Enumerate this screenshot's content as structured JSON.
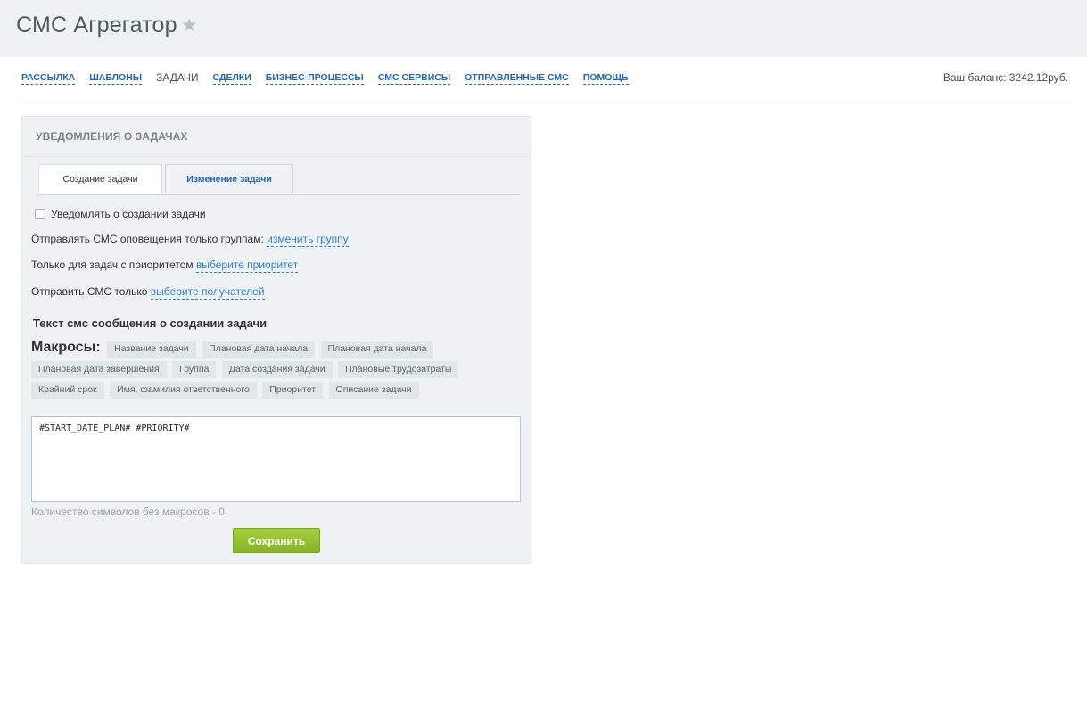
{
  "header": {
    "title": "СМС Агрегатор",
    "star": "★"
  },
  "nav": {
    "items": [
      "РАССЫЛКА",
      "ШАБЛОНЫ",
      "ЗАДАЧИ",
      "СДЕЛКИ",
      "БИЗНЕС-ПРОЦЕССЫ",
      "СМС СЕРВИСЫ",
      "ОТПРАВЛЕННЫЕ СМС",
      "ПОМОЩЬ"
    ],
    "active": "ЗАДАЧИ",
    "balance_label": "Ваш баланс: 3242.12руб."
  },
  "panel": {
    "title": "УВЕДОМЛЕНИЯ О ЗАДАЧАХ",
    "tabs": [
      {
        "label": "Создание задачи"
      },
      {
        "label": "Изменение задачи"
      }
    ],
    "notify_label": "Уведомлять о создании задачи",
    "groups_label": "Отправлять СМС оповещения только группам:",
    "groups_link": "изменить группу",
    "priority_label": "Только для задач с приоритетом",
    "priority_link": "выберите приоритет",
    "recipients_label": "Отправить СМС только",
    "recipients_link": "выберите получателей",
    "section_title": "Текст смс сообщения о создании задачи",
    "macros_label": "Макросы:",
    "macros_row1": [
      "Название задачи",
      "Плановая дата начала",
      "Плановая дата начала"
    ],
    "macros_row2": [
      "Плановая дата завершения",
      "Группа",
      "Дата создания задачи",
      "Плановые трудозатраты"
    ],
    "macros_row3": [
      "Крайний срок",
      "Имя, фамилия ответственного",
      "Приоритет",
      "Описание задачи"
    ],
    "textarea_value": "#START_DATE_PLAN# #PRIORITY#",
    "counter": "Количество символов без макросов - 0",
    "save_label": "Сохранить"
  }
}
